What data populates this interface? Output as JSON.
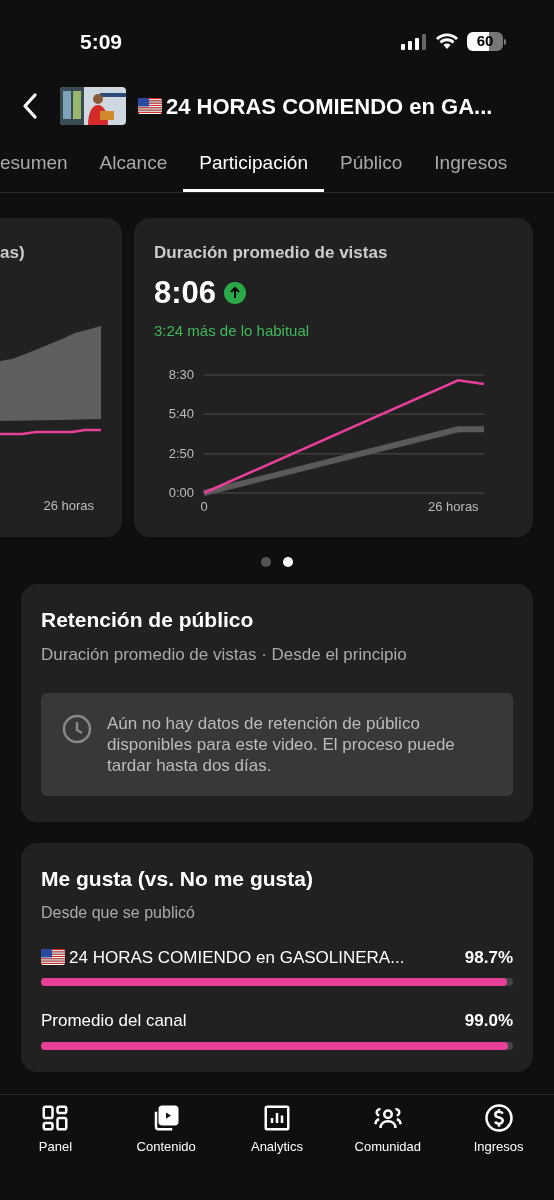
{
  "status_bar": {
    "time": "5:09",
    "battery": "60"
  },
  "header": {
    "title": "24 HORAS COMIENDO en GA..."
  },
  "tabs": [
    {
      "label": "esumen",
      "selected": false
    },
    {
      "label": "Alcance",
      "selected": false
    },
    {
      "label": "Participación",
      "selected": true
    },
    {
      "label": "Público",
      "selected": false
    },
    {
      "label": "Ingresos",
      "selected": false
    }
  ],
  "cards": [
    {
      "title": "as)",
      "x_end_label": "26 horas"
    },
    {
      "title": "Duración promedio de vistas",
      "value": "8:06",
      "note": "3:24 más de lo habitual",
      "chart_data": {
        "type": "line",
        "x": [
          0,
          26.5,
          29.2
        ],
        "xticks": [
          {
            "value": 0,
            "label": "0"
          },
          {
            "value": 26,
            "label": "26 horas"
          }
        ],
        "yticks": [
          {
            "value": 0,
            "label": "0:00"
          },
          {
            "value": 170,
            "label": "2:50"
          },
          {
            "value": 340,
            "label": "5:40"
          },
          {
            "value": 510,
            "label": "8:30"
          }
        ],
        "ylim": [
          0,
          510
        ],
        "xlim": [
          0,
          29.2
        ],
        "series": [
          {
            "color": "#e8409a",
            "values": [
              0,
              487,
              471
            ]
          },
          {
            "color": "#5a5a5a",
            "values": [
              0,
              275,
              275
            ]
          }
        ]
      }
    }
  ],
  "carousel_dots": [
    {
      "selected": false
    },
    {
      "selected": true
    }
  ],
  "retention": {
    "title": "Retención de público",
    "subtitle": "Duración promedio de vistas · Desde el principio",
    "message": "Aún no hay datos de retención de público disponibles para este video. El proceso puede tardar hasta dos días."
  },
  "likes": {
    "title": "Me gusta (vs. No me gusta)",
    "subtitle": "Desde que se publicó",
    "rows": [
      {
        "label": "24 HORAS COMIENDO en GASOLINERA...",
        "flag": true,
        "value": "98.7%",
        "level": 0.987
      },
      {
        "label": "Promedio del canal",
        "flag": false,
        "value": "99.0%",
        "level": 0.99
      }
    ]
  },
  "bottom_nav": [
    {
      "label": "Panel"
    },
    {
      "label": "Contenido"
    },
    {
      "label": "Analytics"
    },
    {
      "label": "Comunidad"
    },
    {
      "label": "Ingresos"
    }
  ]
}
